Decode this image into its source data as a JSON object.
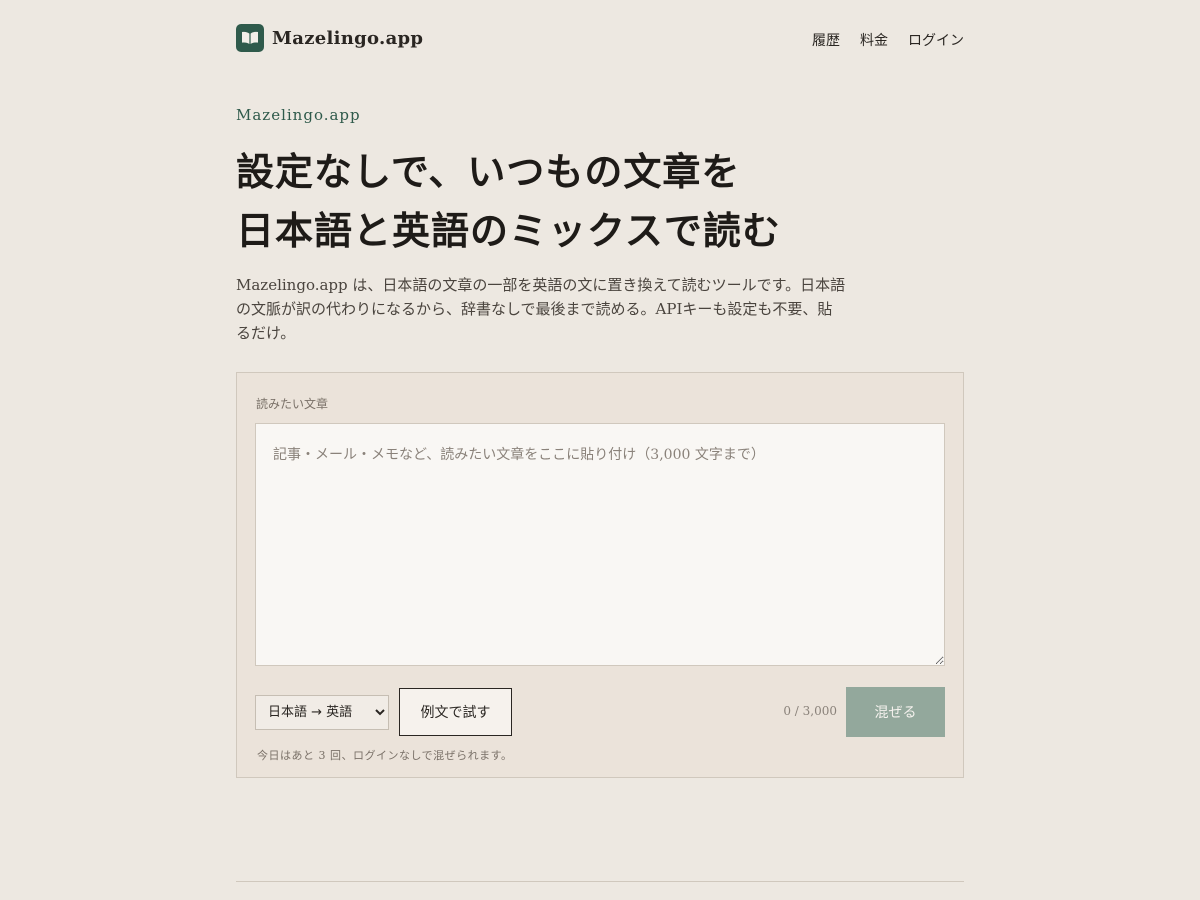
{
  "header": {
    "brand": "Mazelingo.app",
    "nav": [
      "履歴",
      "料金",
      "ログイン"
    ]
  },
  "hero": {
    "eyebrow": "Mazelingo.app",
    "headline_line1": "設定なしで、いつもの文章を",
    "headline_line2": "日本語と英語のミックスで読む",
    "lead": "Mazelingo.app は、日本語の文章の一部を英語の文に置き換えて読むツールです。日本語の文脈が訳の代わりになるから、辞書なしで最後まで読める。APIキーも設定も不要、貼るだけ。"
  },
  "form": {
    "label": "読みたい文章",
    "value": "",
    "placeholder": "記事・メール・メモなど、読みたい文章をここに貼り付け（3,000 文字まで）",
    "language_selected": "日本語 → 英語",
    "try_label": "例文で試す",
    "char_count": "0 / 3,000",
    "mix_label": "混ぜる",
    "note": "今日はあと 3 回、ログインなしで混ぜられます。"
  },
  "colors": {
    "background": "#ede8e1",
    "accent": "#2f5a4b",
    "button_disabled": "#93a89c"
  },
  "icons": {
    "logo": "open-book-icon"
  }
}
